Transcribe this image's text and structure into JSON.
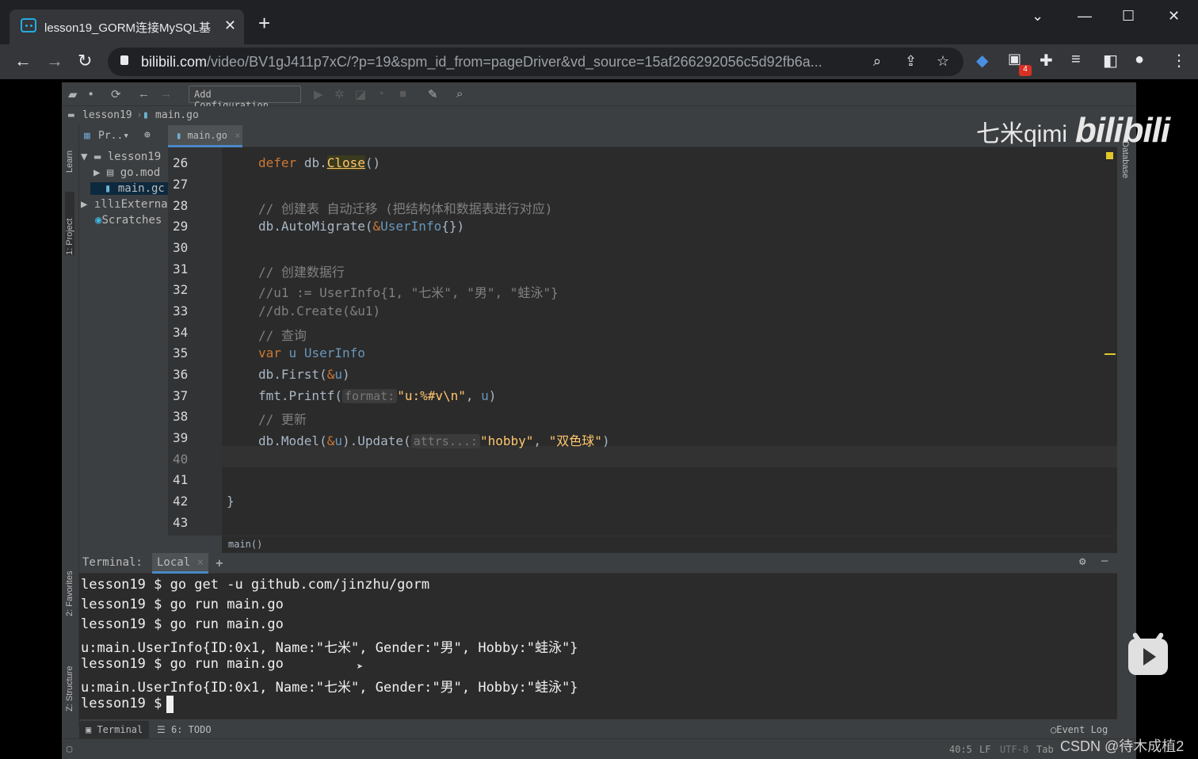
{
  "browser": {
    "tab_title": "lesson19_GORM连接MySQL基",
    "tab_close": "✕",
    "new_tab": "+",
    "url_host": "bilibili.com",
    "url_path": "/video/BV1gJ411p7xC/?p=19&spm_id_from=pageDriver&vd_source=15af266292056c5d92fb6a...",
    "extension_badge": "4"
  },
  "ide": {
    "add_configuration": "Add Configuration...",
    "breadcrumb_project": "lesson19",
    "breadcrumb_file": "main.go",
    "project_label": "Pr..▾",
    "left_strip": {
      "learn": "Learn",
      "project": "1: Project",
      "favorites": "2: Favorites",
      "structure": "Z: Structure"
    },
    "right_strip": {
      "database": "Database"
    },
    "tree": [
      {
        "label": "lesson19",
        "arrow": "▼"
      },
      {
        "label": "go.mod",
        "arrow": "▶"
      },
      {
        "label": "main.gc",
        "arrow": ""
      },
      {
        "label": "External",
        "arrow": "▶"
      },
      {
        "label": "Scratches",
        "arrow": ""
      }
    ],
    "editor_tab": "main.go",
    "line_numbers": [
      "26",
      "27",
      "28",
      "29",
      "30",
      "31",
      "32",
      "33",
      "34",
      "35",
      "36",
      "37",
      "38",
      "39",
      "40",
      "41",
      "42",
      "43"
    ],
    "code": {
      "l26_kw": "defer",
      "l26_obj": "db.",
      "l26_fn": "Close",
      "l26_end": "()",
      "l28": "// 创建表 自动迁移 (把结构体和数据表进行对应)",
      "l29_a": "db.AutoMigrate(",
      "l29_amp": "&",
      "l29_t": "UserInfo",
      "l29_b": "{})",
      "l31": "// 创建数据行",
      "l32": "//u1 := UserInfo{1, \"七米\", \"男\", \"蛙泳\"}",
      "l33": "//db.Create(&u1)",
      "l34": "// 查询",
      "l35_kw": "var",
      "l35_v": "u",
      "l35_t": "UserInfo",
      "l36_a": "db.First(",
      "l36_amp": "&",
      "l36_v": "u",
      "l36_b": ")",
      "l37_a": "fmt.Printf(",
      "l37_hint": "format:",
      "l37_s": "\"u:%#v\\n\"",
      "l37_c": ", ",
      "l37_v": "u",
      "l37_b": ")",
      "l38": "// 更新",
      "l39_a": "db.Model(",
      "l39_amp": "&",
      "l39_v": "u",
      "l39_b": ").Update(",
      "l39_hint": "attrs...:",
      "l39_s1": "\"hobby\"",
      "l39_c": ", ",
      "l39_s2": "\"双色球\"",
      "l39_e": ")",
      "l42": "}"
    },
    "function_breadcrumb": "main()",
    "terminal": {
      "title": "Terminal:",
      "tab": "Local",
      "add": "+",
      "lines": [
        "lesson19 $ go get -u github.com/jinzhu/gorm",
        "lesson19 $ go run main.go",
        "lesson19 $ go run main.go",
        "u:main.UserInfo{ID:0x1, Name:\"七米\", Gender:\"男\", Hobby:\"蛙泳\"}",
        "lesson19 $ go run main.go",
        "u:main.UserInfo{ID:0x1, Name:\"七米\", Gender:\"男\", Hobby:\"蛙泳\"}",
        "lesson19 $ "
      ]
    },
    "bottom_tabs": {
      "terminal": "Terminal",
      "todo": "6: TODO",
      "event_log": "Event Log"
    },
    "status": {
      "position": "40:5",
      "line_sep": "LF",
      "encoding": "UTF-8",
      "indent": "Tab"
    }
  },
  "overlay": {
    "watermark_text": "七米qimi",
    "watermark_logo": "bilibili",
    "csdn": "CSDN @待木成植2"
  },
  "colors": {
    "keyword": "#cc7832",
    "comment": "#808080",
    "function": "#ffc66d",
    "type": "#6897bb",
    "bilibili_blue": "#23ade5"
  }
}
